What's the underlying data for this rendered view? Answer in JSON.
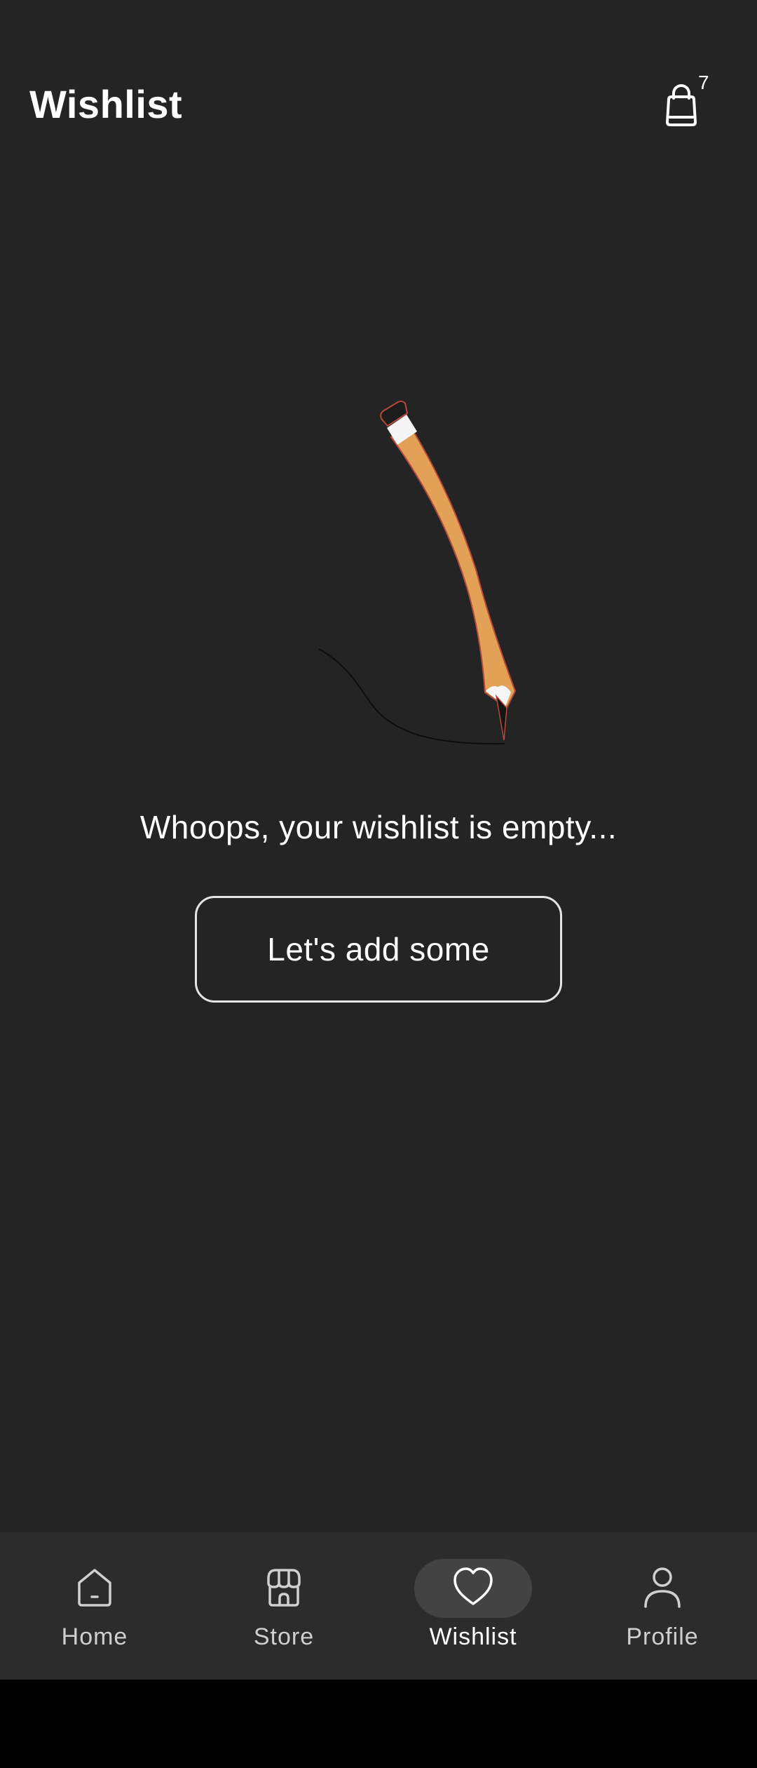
{
  "header": {
    "title": "Wishlist",
    "cart_icon": "shopping-bag-icon",
    "cart_count": "7"
  },
  "empty_state": {
    "illustration": "pencil-drawing-illustration",
    "message": "Whoops, your wishlist is empty...",
    "button_label": "Let's add some"
  },
  "bottom_nav": {
    "active": "Wishlist",
    "items": [
      {
        "label": "Home",
        "icon": "home-icon"
      },
      {
        "label": "Store",
        "icon": "store-icon"
      },
      {
        "label": "Wishlist",
        "icon": "heart-icon"
      },
      {
        "label": "Profile",
        "icon": "profile-icon"
      }
    ]
  },
  "colors": {
    "background": "#242424",
    "nav_background": "#2c2c2c",
    "active_pill": "#434343",
    "pencil_body": "#e3a157"
  }
}
